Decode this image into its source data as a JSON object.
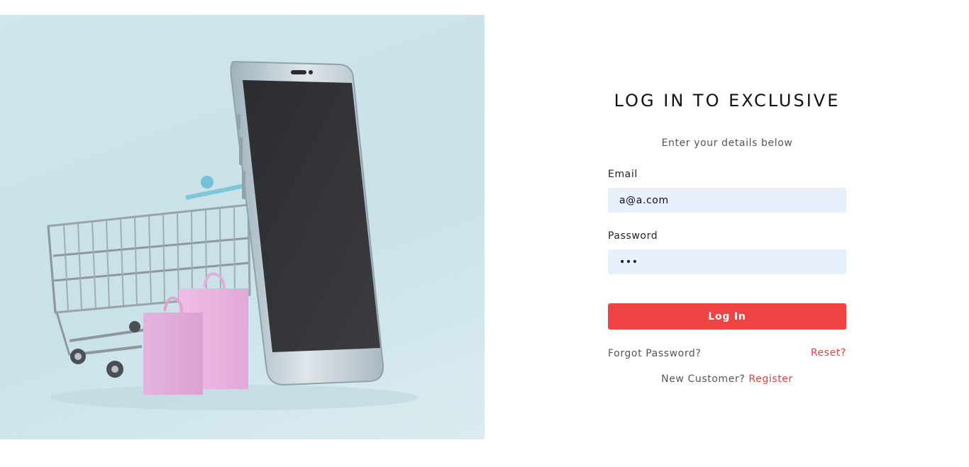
{
  "hero": {
    "image": "shopping-cart-smartphone-bags-illustration"
  },
  "login": {
    "title": "LOG IN TO EXCLUSIVE",
    "subtitle": "Enter your details below",
    "email_label": "Email",
    "email_value": "a@a.com",
    "password_label": "Password",
    "password_value": "abc",
    "submit_label": "Log In",
    "forgot_text": "Forgot Password?",
    "reset_link": "Reset?",
    "new_customer_text": "New Customer?",
    "register_link": "Register"
  },
  "colors": {
    "accent": "#ef4444",
    "link": "#e53e3e",
    "input_bg": "#e8f0fe",
    "hero_bg": "#c8e2e8"
  }
}
